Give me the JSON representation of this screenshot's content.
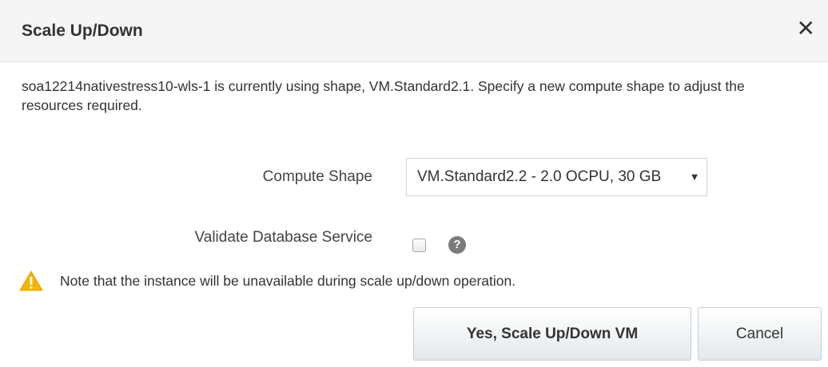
{
  "dialog": {
    "title": "Scale Up/Down",
    "close_symbol": "✕",
    "message": "soa12214nativestress10-wls-1 is currently using shape, VM.Standard2.1. Specify a new compute shape to adjust the resources required."
  },
  "form": {
    "compute_shape": {
      "label": "Compute Shape",
      "selected_value": "VM.Standard2.2 - 2.0 OCPU, 30 GB"
    },
    "validate_db": {
      "label": "Validate Database Service",
      "checked": false,
      "help_symbol": "?"
    }
  },
  "note": {
    "icon": "warning-icon",
    "text": "Note that the instance will be unavailable during scale up/down operation."
  },
  "buttons": {
    "confirm_label": "Yes, Scale Up/Down VM",
    "cancel_label": "Cancel"
  },
  "colors": {
    "warning": "#f4b400",
    "header_bg": "#f5f5f5",
    "help_icon": "#7b7b7b"
  }
}
